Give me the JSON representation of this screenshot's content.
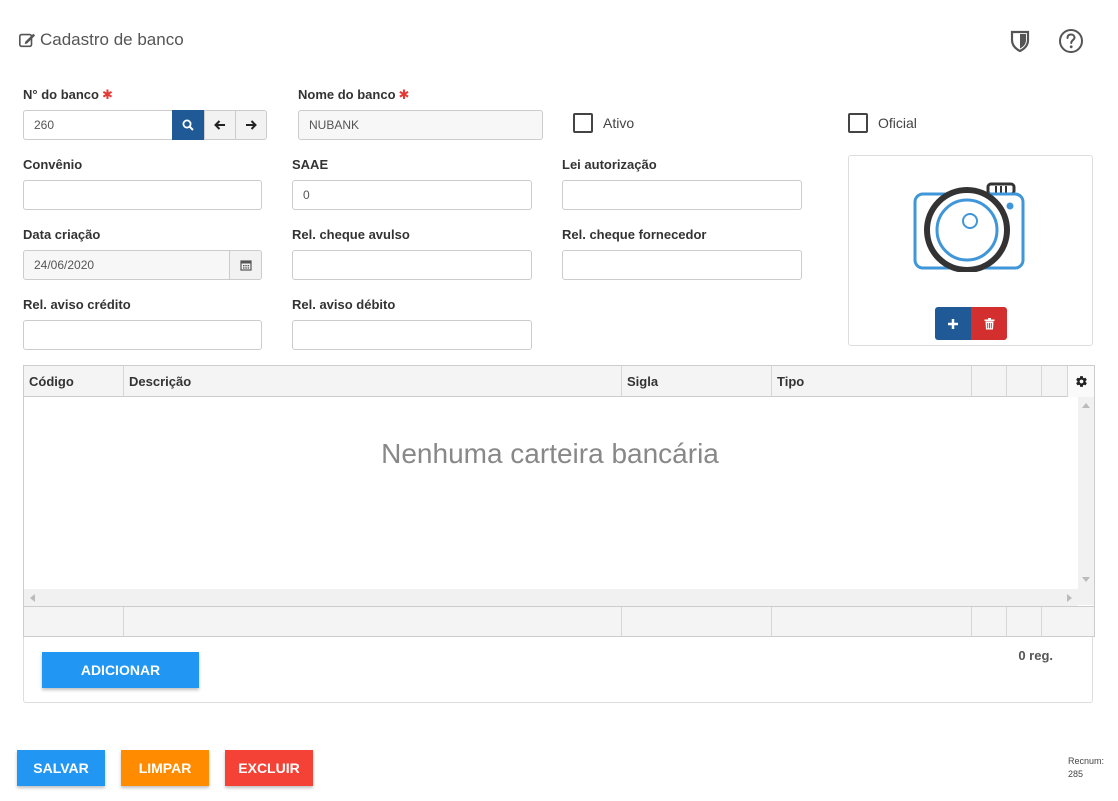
{
  "header": {
    "title": "Cadastro de banco",
    "icons": [
      "edit-icon",
      "shield-icon",
      "help-icon"
    ]
  },
  "form": {
    "numero": {
      "label": "N° do banco",
      "value": "260"
    },
    "nome": {
      "label": "Nome do banco",
      "value": "NUBANK"
    },
    "ativo": {
      "label": "Ativo",
      "checked": false
    },
    "oficial": {
      "label": "Oficial",
      "checked": false
    },
    "convenio": {
      "label": "Convênio",
      "value": ""
    },
    "saae": {
      "label": "SAAE",
      "value": "0"
    },
    "lei": {
      "label": "Lei autorização",
      "value": ""
    },
    "data": {
      "label": "Data criação",
      "value": "24/06/2020"
    },
    "cheque_avulso": {
      "label": "Rel. cheque avulso",
      "value": ""
    },
    "cheque_fornecedor": {
      "label": "Rel. cheque fornecedor",
      "value": ""
    },
    "aviso_credito": {
      "label": "Rel. aviso crédito",
      "value": ""
    },
    "aviso_debito": {
      "label": "Rel. aviso débito",
      "value": ""
    },
    "required_mark": "✱"
  },
  "grid": {
    "columns": [
      "Código",
      "Descrição",
      "Sigla",
      "Tipo"
    ],
    "empty_message": "Nenhuma carteira bancária",
    "count": "0 reg.",
    "add_label": "ADICIONAR"
  },
  "footer": {
    "save_label": "SALVAR",
    "clear_label": "LIMPAR",
    "delete_label": "EXCLUIR",
    "recnum_label": "Recnum:",
    "recnum_value": "285"
  },
  "colors": {
    "primary": "#1f5a96",
    "save": "#2196f3",
    "clear": "#ff8c00",
    "delete": "#f44336",
    "camera": "#3f96d8"
  }
}
